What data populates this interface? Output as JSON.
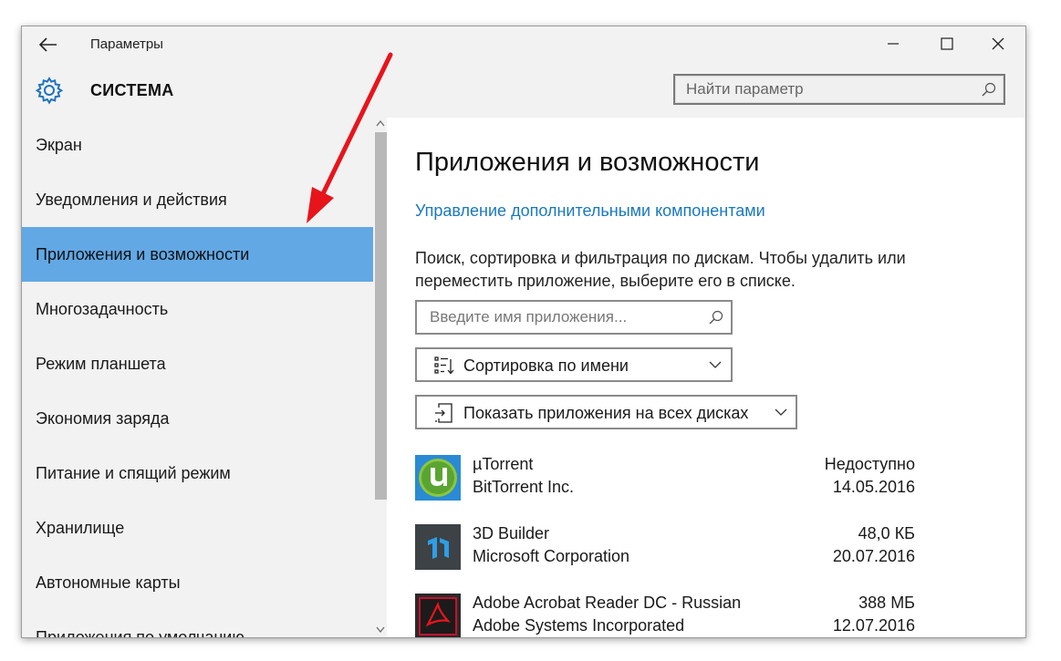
{
  "window": {
    "title": "Параметры"
  },
  "header": {
    "section_title": "СИСТЕМА",
    "search_placeholder": "Найти параметр"
  },
  "sidebar": {
    "items": [
      {
        "label": "Экран"
      },
      {
        "label": "Уведомления и действия"
      },
      {
        "label": "Приложения и возможности",
        "selected": true
      },
      {
        "label": "Многозадачность"
      },
      {
        "label": "Режим планшета"
      },
      {
        "label": "Экономия заряда"
      },
      {
        "label": "Питание и спящий режим"
      },
      {
        "label": "Хранилище"
      },
      {
        "label": "Автономные карты"
      },
      {
        "label": "Приложения по умолчанию"
      }
    ]
  },
  "main": {
    "title": "Приложения и возможности",
    "manage_link": "Управление дополнительными компонентами",
    "description": "Поиск, сортировка и фильтрация по дискам. Чтобы удалить или переместить приложение, выберите его в списке.",
    "app_search_placeholder": "Введите имя приложения...",
    "sort_label": "Сортировка по имени",
    "filter_label": "Показать приложения на всех дисках",
    "apps": [
      {
        "name": "µTorrent",
        "publisher": "BitTorrent Inc.",
        "size": "Недоступно",
        "date": "14.05.2016",
        "icon": "utorrent-icon"
      },
      {
        "name": "3D Builder",
        "publisher": "Microsoft Corporation",
        "size": "48,0 КБ",
        "date": "20.07.2016",
        "icon": "3d-builder-icon"
      },
      {
        "name": "Adobe Acrobat Reader DC - Russian",
        "publisher": "Adobe Systems Incorporated",
        "size": "388 МБ",
        "date": "12.07.2016",
        "icon": "acrobat-icon"
      }
    ]
  },
  "colors": {
    "accent": "#62a8e5",
    "link": "#1978bf",
    "annotation_arrow": "#e8141c"
  }
}
